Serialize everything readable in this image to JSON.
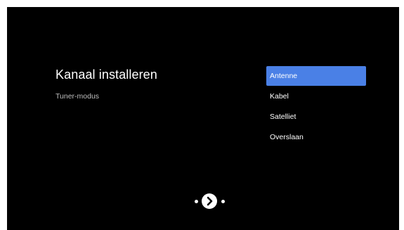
{
  "screen": {
    "title": "Kanaal installeren",
    "subtitle": "Tuner-modus"
  },
  "menu": {
    "selected_index": 0,
    "items": [
      {
        "label": "Antenne"
      },
      {
        "label": "Kabel"
      },
      {
        "label": "Satelliet"
      },
      {
        "label": "Overslaan"
      }
    ]
  },
  "pager": {
    "icons": [
      "dot-icon",
      "chevron-right-icon",
      "dot-icon"
    ]
  },
  "colors": {
    "background": "#000000",
    "selection": "#4a80e6",
    "text": "#ffffff",
    "subtext": "#bdbdbd"
  }
}
